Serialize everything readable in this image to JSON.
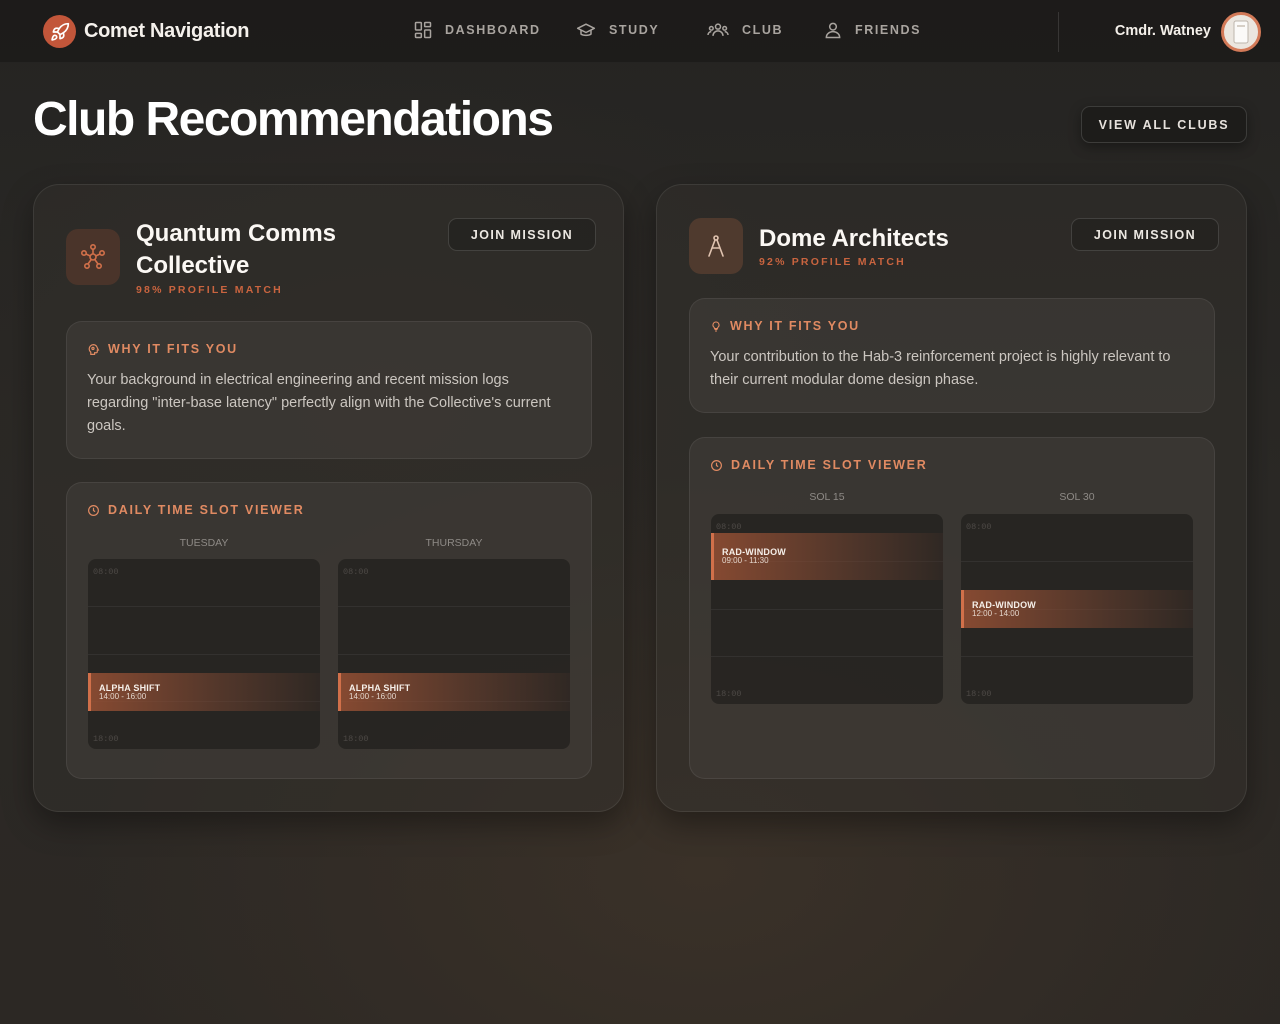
{
  "brand": {
    "name": "Comet Navigation",
    "icon": "rocket-icon"
  },
  "nav": [
    {
      "label": "DASHBOARD",
      "icon": "dashboard-icon"
    },
    {
      "label": "STUDY",
      "icon": "graduation-cap-icon"
    },
    {
      "label": "CLUB",
      "icon": "group-icon"
    },
    {
      "label": "FRIENDS",
      "icon": "person-icon"
    }
  ],
  "user": {
    "name": "Cmdr. Watney",
    "avatar_icon": "avatar-icon"
  },
  "page": {
    "title": "Club Recommendations",
    "view_all_label": "VIEW ALL CLUBS"
  },
  "colors": {
    "accent": "#d1704a",
    "accent_text": "#e08a62",
    "background": "#2a2825"
  },
  "clubs": [
    {
      "name": "Quantum Comms Collective",
      "icon": "network-nodes-icon",
      "match": "98% PROFILE MATCH",
      "join_label": "JOIN MISSION",
      "fit_heading": "WHY IT FITS YOU",
      "fit_text": "Your background in electrical engineering and recent mission logs regarding \"inter-base latency\" perfectly align with the Collective's current goals.",
      "slots_heading": "DAILY TIME SLOT VIEWER",
      "days": [
        {
          "label": "TUESDAY",
          "start_time": "08:00",
          "end_time": "18:00",
          "event": {
            "title": "ALPHA SHIFT",
            "time": "14:00 - 16:00"
          }
        },
        {
          "label": "THURSDAY",
          "start_time": "08:00",
          "end_time": "18:00",
          "event": {
            "title": "ALPHA SHIFT",
            "time": "14:00 - 16:00"
          }
        }
      ]
    },
    {
      "name": "Dome Architects",
      "icon": "compass-icon",
      "match": "92% PROFILE MATCH",
      "join_label": "JOIN MISSION",
      "fit_heading": "WHY IT FITS YOU",
      "fit_text": "Your contribution to the Hab-3 reinforcement project is highly relevant to their current modular dome design phase.",
      "slots_heading": "DAILY TIME SLOT VIEWER",
      "days": [
        {
          "label": "SOL 15",
          "start_time": "08:00",
          "end_time": "18:00",
          "event": {
            "title": "RAD-WINDOW",
            "time": "09:00 - 11:30"
          }
        },
        {
          "label": "SOL 30",
          "start_time": "08:00",
          "end_time": "18:00",
          "event": {
            "title": "RAD-WINDOW",
            "time": "12:00 - 14:00"
          }
        }
      ]
    }
  ]
}
